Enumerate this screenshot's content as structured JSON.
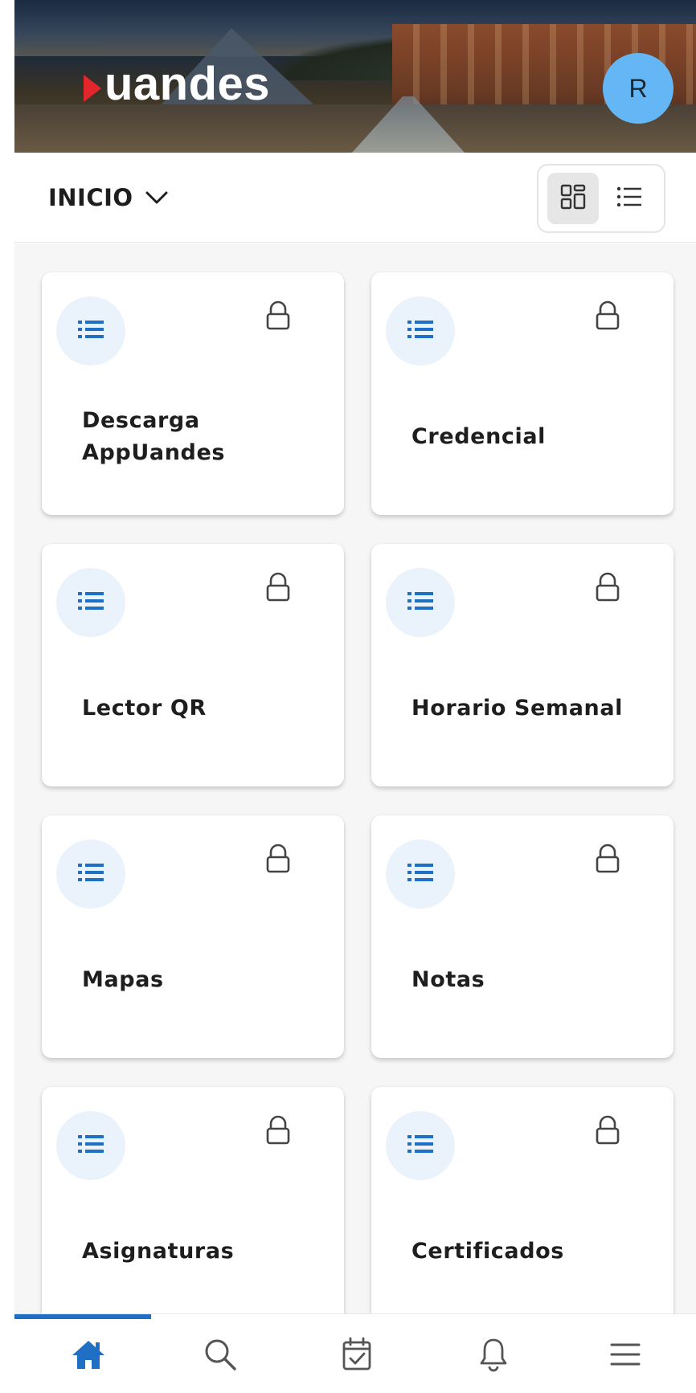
{
  "header": {
    "logo_text": "uandes",
    "avatar_initial": "R"
  },
  "titlebar": {
    "title": "INICIO",
    "view_modes": [
      "grid-view-icon",
      "list-view-icon"
    ],
    "active_view": "grid"
  },
  "cards": [
    {
      "label": "Descarga AppUandes",
      "icon": "list-icon",
      "locked": true
    },
    {
      "label": "Credencial",
      "icon": "list-icon",
      "locked": true
    },
    {
      "label": "Lector QR",
      "icon": "list-icon",
      "locked": true
    },
    {
      "label": "Horario Semanal",
      "icon": "list-icon",
      "locked": true
    },
    {
      "label": "Mapas",
      "icon": "list-icon",
      "locked": true
    },
    {
      "label": "Notas",
      "icon": "list-icon",
      "locked": true
    },
    {
      "label": "Asignaturas",
      "icon": "list-icon",
      "locked": true
    },
    {
      "label": "Certificados",
      "icon": "list-icon",
      "locked": true
    }
  ],
  "bottom_nav": {
    "items": [
      "home-icon",
      "search-icon",
      "calendar-check-icon",
      "bell-icon",
      "menu-icon"
    ],
    "active": "home-icon"
  },
  "colors": {
    "brand_red": "#e3262b",
    "accent_blue": "#1f6fc4",
    "avatar_blue": "#64b7f4",
    "icon_circle_bg": "#eaf2fb"
  }
}
